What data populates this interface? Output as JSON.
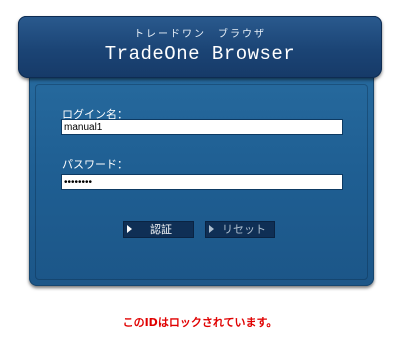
{
  "header": {
    "subtitle": "トレードワン　ブラウザ",
    "title": "TradeOne Browser"
  },
  "login": {
    "login_label": "ログイン名：",
    "login_value": "manual1",
    "password_label": "パスワード：",
    "password_mask": "••••••••"
  },
  "buttons": {
    "auth_label": "認証",
    "reset_label": "リセット"
  },
  "message": {
    "error": "このIDはロックされています。"
  },
  "colors": {
    "panel": "#1f5f93",
    "header": "#1b4475",
    "error": "#e00000"
  }
}
